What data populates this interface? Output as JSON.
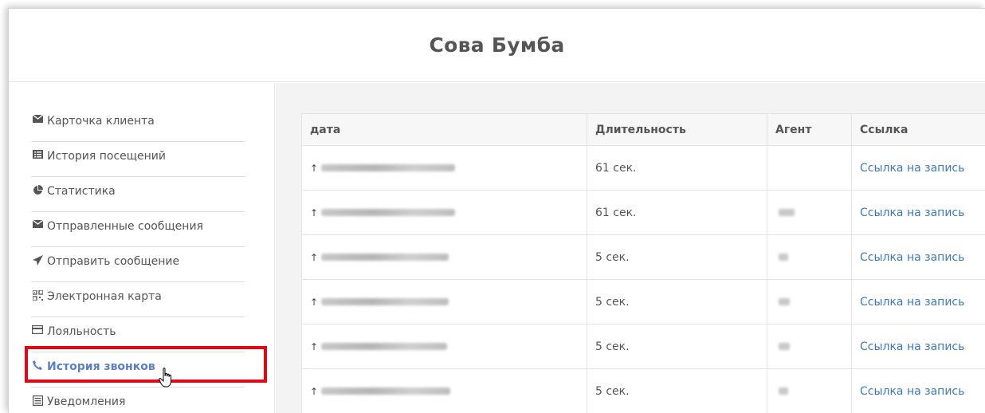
{
  "header": {
    "title": "Сова Бумба"
  },
  "sidebar": {
    "items": [
      {
        "label": "Карточка клиента",
        "icon": "envelope-icon"
      },
      {
        "label": "История посещений",
        "icon": "list-icon"
      },
      {
        "label": "Статистика",
        "icon": "pie-chart-icon"
      },
      {
        "label": "Отправленные сообщения",
        "icon": "envelope-icon"
      },
      {
        "label": "Отправить сообщение",
        "icon": "paper-plane-icon"
      },
      {
        "label": "Электронная карта",
        "icon": "qrcode-icon"
      },
      {
        "label": "Лояльность",
        "icon": "credit-card-icon"
      },
      {
        "label": "История звонков",
        "icon": "phone-icon",
        "active": true
      },
      {
        "label": "Уведомления",
        "icon": "list-alt-icon"
      }
    ]
  },
  "table": {
    "headers": [
      "дата",
      "Длительность",
      "Агент",
      "Ссылка"
    ],
    "rows": [
      {
        "duration": "61 сек.",
        "link": "Ссылка на запись"
      },
      {
        "duration": "61 сек.",
        "link": "Ссылка на запись"
      },
      {
        "duration": "5 сек.",
        "link": "Ссылка на запись"
      },
      {
        "duration": "5 сек.",
        "link": "Ссылка на запись"
      },
      {
        "duration": "5 сек.",
        "link": "Ссылка на запись"
      },
      {
        "duration": "5 сек.",
        "link": "Ссылка на запись"
      }
    ]
  },
  "colors": {
    "accent": "#5b7fbf",
    "highlight": "#e30613",
    "link": "#3a7ac0"
  }
}
